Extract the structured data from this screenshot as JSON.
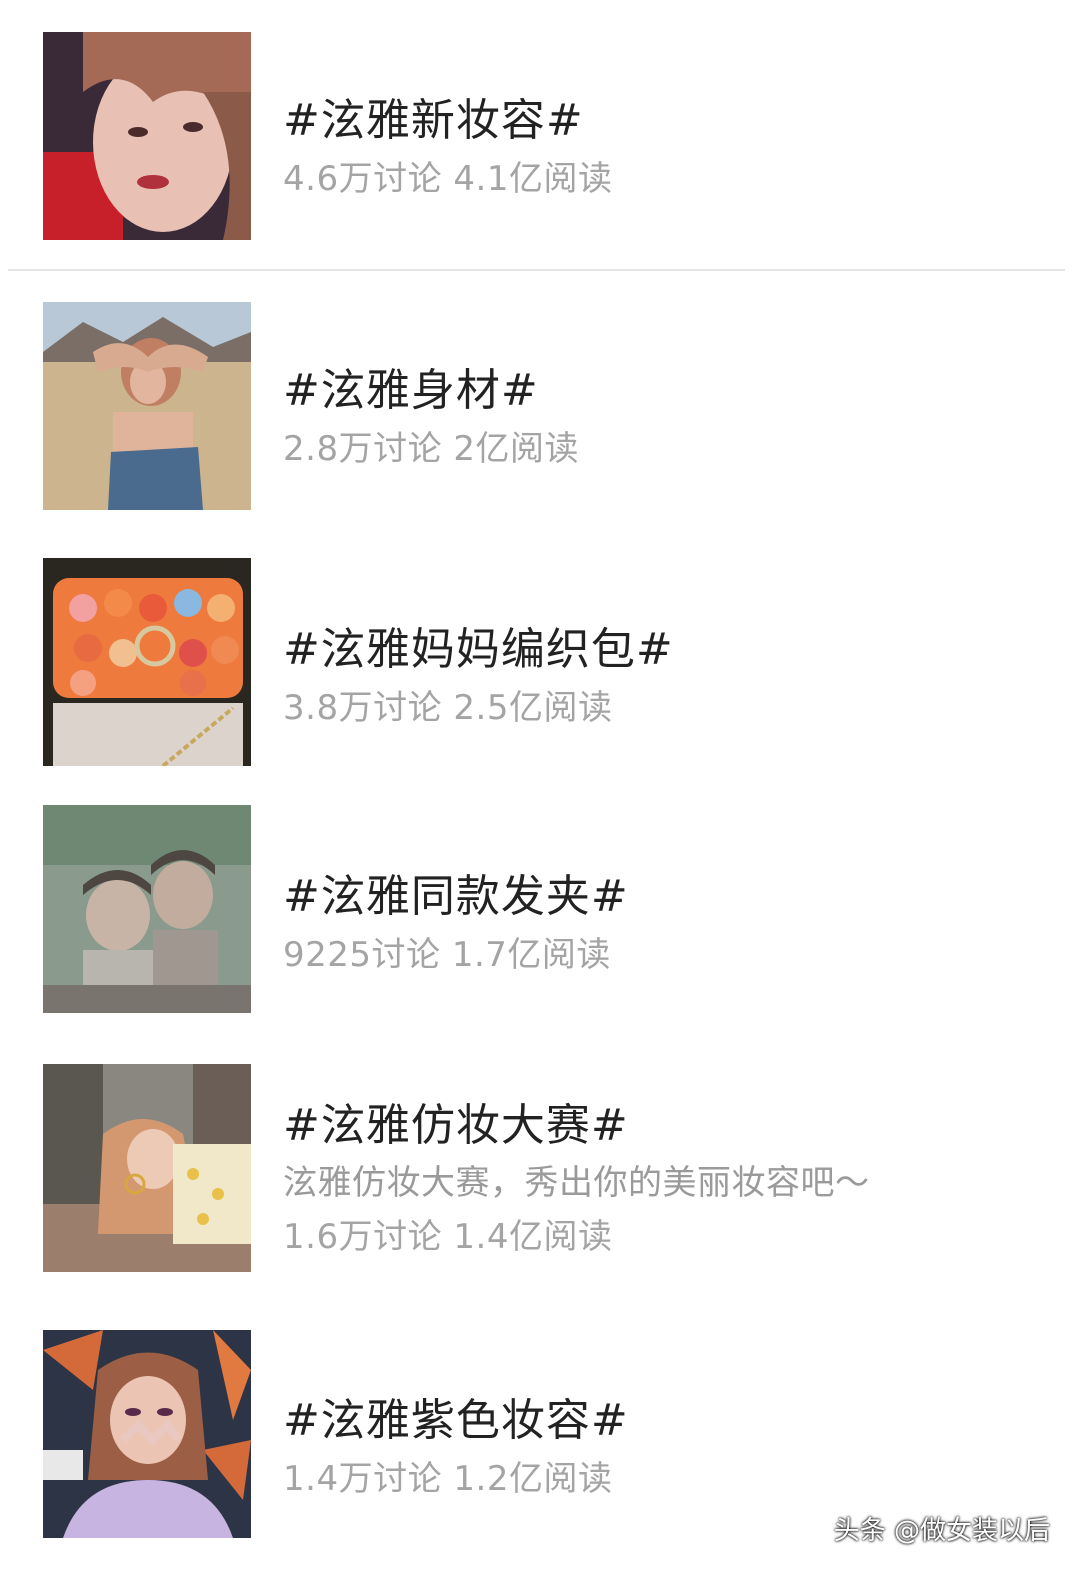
{
  "topics": [
    {
      "title": "#泫雅新妆容#",
      "description": "",
      "stats": "4.6万讨论 4.1亿阅读",
      "thumbnail": "portrait-red-hair-icon"
    },
    {
      "title": "#泫雅身材#",
      "description": "",
      "stats": "2.8万讨论 2亿阅读",
      "thumbnail": "desert-portrait-icon"
    },
    {
      "title": "#泫雅妈妈编织包#",
      "description": "",
      "stats": "3.8万讨论 2.5亿阅读",
      "thumbnail": "knitted-bag-icon"
    },
    {
      "title": "#泫雅同款发夹#",
      "description": "",
      "stats": "9225讨论 1.7亿阅读",
      "thumbnail": "childhood-photo-icon"
    },
    {
      "title": "#泫雅仿妆大赛#",
      "description": "泫雅仿妆大赛，秀出你的美丽妆容吧～",
      "stats": "1.6万讨论 1.4亿阅读",
      "thumbnail": "street-portrait-icon"
    },
    {
      "title": "#泫雅紫色妆容#",
      "description": "",
      "stats": "1.4万讨论 1.2亿阅读",
      "thumbnail": "purple-makeup-portrait-icon"
    }
  ],
  "watermark": "头条 @做女装以后",
  "colors": {
    "title": "#222222",
    "meta": "#a4a4a4",
    "divider": "#e6e6e6"
  }
}
